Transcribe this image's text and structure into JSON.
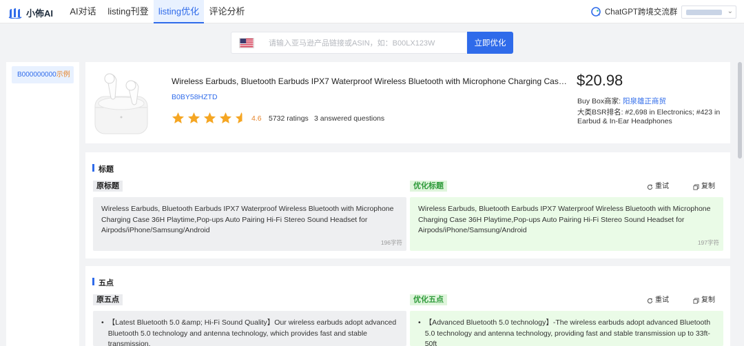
{
  "app": {
    "name": "小佈AI"
  },
  "nav": {
    "tabs": [
      {
        "label": "AI对话"
      },
      {
        "label": "listing刊登"
      },
      {
        "label": "listing优化"
      },
      {
        "label": "评论分析"
      }
    ],
    "active_tab": "listing优化",
    "community": "ChatGPT跨境交流群"
  },
  "search": {
    "placeholder": "请输入亚马逊产品链接或ASIN，如：B00LX123W",
    "value": "",
    "marketplace_icon": "us-flag-icon",
    "button_label": "立即优化"
  },
  "sidebar": {
    "items": [
      {
        "asin": "B000000000",
        "tag": "示例"
      }
    ]
  },
  "product": {
    "title": "Wireless Earbuds, Bluetooth Earbuds IPX7 Waterproof Wireless Bluetooth with Microphone Charging Case 36H Playtime,Pop-ups Auto Pairing Hi-Fi Stereo Sound Headset for Airpods/iPhone/Samsung/Android",
    "asin": "B0BY58HZTD",
    "rating": 4.6,
    "rating_label": "4.6",
    "ratings_count": "5732 ratings",
    "answered": "3 answered questions",
    "price": "$20.98",
    "buybox_label": "Buy Box商家:",
    "buybox_seller": "阳泉雄正商贸",
    "bsr": "大类BSR排名: #2,698 in Electronics; #423 in Earbud & In-Ear Headphones"
  },
  "title_section": {
    "heading": "标题",
    "original_label": "原标题",
    "optimized_label": "优化标题",
    "retry_label": "重试",
    "copy_label": "复制",
    "original_text": "Wireless Earbuds, Bluetooth Earbuds IPX7 Waterproof Wireless Bluetooth with Microphone Charging Case 36H Playtime,Pop-ups Auto Pairing Hi-Fi Stereo Sound Headset for Airpods/iPhone/Samsung/Android",
    "original_count": "196字符",
    "optimized_text": "Wireless Earbuds, Bluetooth Earbuds IPX7 Waterproof Wireless Bluetooth with Microphone Charging Case 36H Playtime,Pop-ups Auto Pairing Hi-Fi Stereo Sound Headset for Airpods/iPhone/Samsung/Android",
    "optimized_count": "197字符"
  },
  "bullets_section": {
    "heading": "五点",
    "original_label": "原五点",
    "optimized_label": "优化五点",
    "retry_label": "重试",
    "copy_label": "复制",
    "original_first": "【Latest Bluetooth 5.0 &amp; Hi-Fi Sound Quality】Our wireless earbuds adopt advanced Bluetooth 5.0 technology and antenna technology, which provides fast and stable transmission,",
    "optimized_first": "【Advanced Bluetooth 5.0 technology】-The wireless earbuds adopt advanced Bluetooth 5.0 technology and antenna technology, providing fast and stable transmission up to 33ft-50ft"
  },
  "colors": {
    "primary": "#2f6bea",
    "star": "#f5a623",
    "rating_orange": "#e6852b",
    "optimized_green": "#2e9a3a"
  }
}
